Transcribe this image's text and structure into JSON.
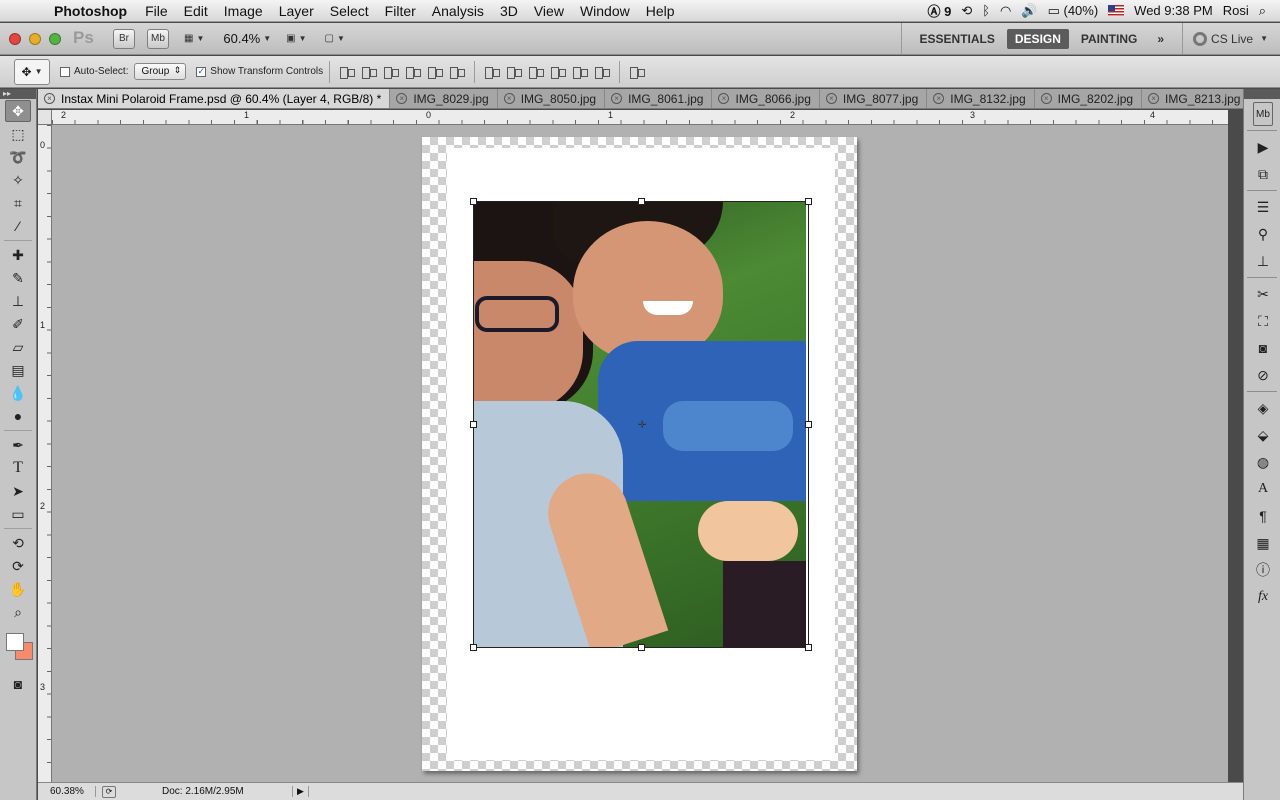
{
  "menubar": {
    "app_name": "Photoshop",
    "items": [
      "File",
      "Edit",
      "Image",
      "Layer",
      "Select",
      "Filter",
      "Analysis",
      "3D",
      "View",
      "Window",
      "Help"
    ],
    "status": {
      "adobe_count": "9",
      "battery": "(40%)",
      "clock": "Wed 9:38 PM",
      "user": "Rosi"
    }
  },
  "appbar": {
    "bridge_label": "Br",
    "minibridge_label": "Mb",
    "zoom": "60.4%",
    "workspaces": [
      "ESSENTIALS",
      "DESIGN",
      "PAINTING"
    ],
    "active_workspace": "DESIGN",
    "more": "»",
    "cs_live": "CS Live"
  },
  "options": {
    "auto_select_label": "Auto-Select:",
    "auto_select_value": "Group",
    "show_transform_label": "Show Transform Controls"
  },
  "tabs": [
    {
      "label": "Instax Mini Polaroid Frame.psd @ 60.4% (Layer 4, RGB/8) *",
      "active": true
    },
    {
      "label": "IMG_8029.jpg"
    },
    {
      "label": "IMG_8050.jpg"
    },
    {
      "label": "IMG_8061.jpg"
    },
    {
      "label": "IMG_8066.jpg"
    },
    {
      "label": "IMG_8077.jpg"
    },
    {
      "label": "IMG_8132.jpg"
    },
    {
      "label": "IMG_8202.jpg"
    },
    {
      "label": "IMG_8213.jpg"
    }
  ],
  "rulers": {
    "top": [
      "2",
      "1",
      "0",
      "1",
      "2",
      "3",
      "4"
    ],
    "left": [
      "0",
      "1",
      "2",
      "3"
    ]
  },
  "colors": {
    "foreground": "#ffffff",
    "background": "#f58b6c",
    "active_workspace_bg": "#5b5b5b"
  },
  "statusbar": {
    "zoom": "60.38%",
    "doc": "Doc: 2.16M/2.95M"
  }
}
